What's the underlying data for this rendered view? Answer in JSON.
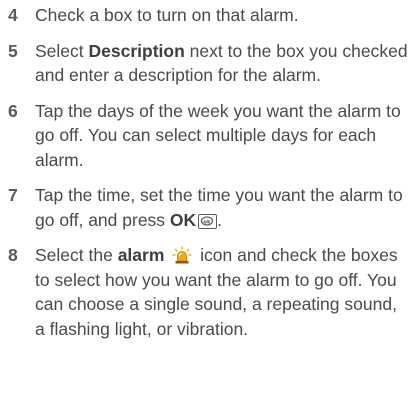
{
  "steps": [
    {
      "number": "4",
      "text": "Check a box to turn on that alarm."
    },
    {
      "number": "5",
      "prefix": "Select ",
      "bold": "Description",
      "suffix": " next to the box you checked and enter a description for the alarm."
    },
    {
      "number": "6",
      "text": "Tap the days of the week you want the alarm to go off. You can select multiple days for each alarm."
    },
    {
      "number": "7",
      "prefix": "Tap the time, set the time you want the alarm to go off, and press ",
      "bold": "OK",
      "suffix": "."
    },
    {
      "number": "8",
      "prefix": "Select the ",
      "bold": "alarm",
      "suffix": " icon and check the boxes to select how you want the alarm to go off. You can choose a single sound, a repeating sound, a flashing light, or vibration."
    }
  ],
  "icons": {
    "ok_key": "ok-key-icon",
    "alarm": "alarm-light-icon"
  },
  "colors": {
    "text": "#4a4a4a",
    "alarm_light": "#f2a91c"
  }
}
